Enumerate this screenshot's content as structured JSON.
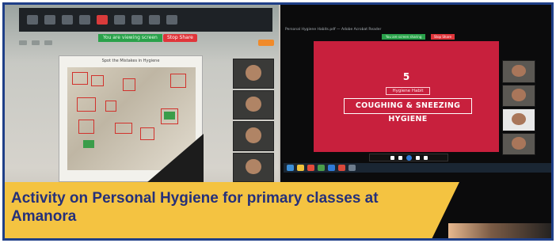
{
  "caption": {
    "text": "Activity on Personal Hygiene for primary classes at Amanora"
  },
  "left_screen": {
    "sharing_banner": "You are viewing screen",
    "stop_share": "Stop Share",
    "worksheet_title": "Spot the Mistakes in Hygiene"
  },
  "right_screen": {
    "address_bar": "Personal Hygiene Habits.pdf — Adobe Acrobat Reader",
    "sharing_banner": "You are screen sharing",
    "stop_share": "Stop Share",
    "slide": {
      "number": "5",
      "tag": "Hygiene Habit",
      "heading": "COUGHING & SNEEZING HYGIENE"
    }
  },
  "colors": {
    "frame_border": "#1f3f88",
    "caption_bg": "#f4c341",
    "caption_text": "#25307a",
    "slide_bg": "#c8203d"
  }
}
